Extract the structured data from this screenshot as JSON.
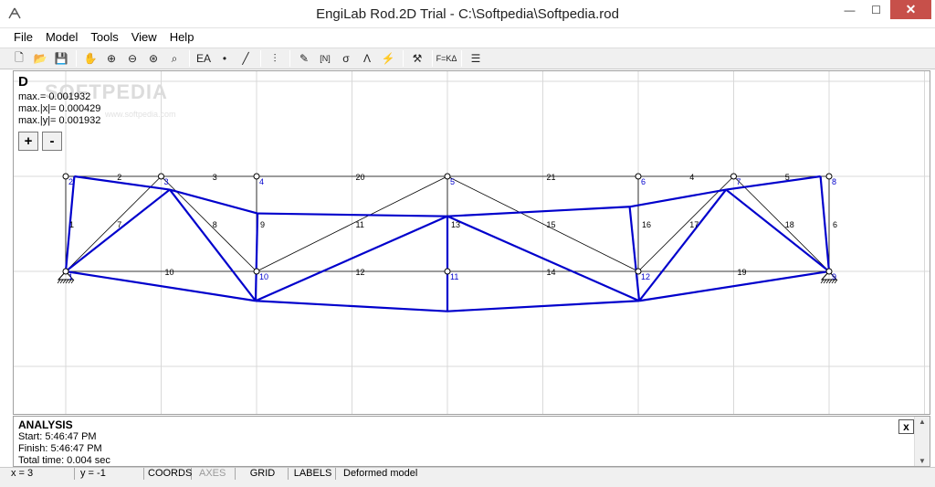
{
  "window": {
    "title": "EngiLab Rod.2D Trial - C:\\Softpedia\\Softpedia.rod",
    "minimize": "—",
    "maximize": "☐",
    "close": "✕"
  },
  "menu": [
    "File",
    "Model",
    "Tools",
    "View",
    "Help"
  ],
  "toolbar": [
    {
      "icon": "new-file-icon",
      "glyph": "🗋"
    },
    {
      "icon": "open-folder-icon",
      "glyph": "📂"
    },
    {
      "icon": "save-icon",
      "glyph": "💾"
    },
    {
      "sep": true
    },
    {
      "icon": "pan-hand-icon",
      "glyph": "✋"
    },
    {
      "icon": "zoom-in-icon",
      "glyph": "⊕"
    },
    {
      "icon": "zoom-out-icon",
      "glyph": "⊖"
    },
    {
      "icon": "zoom-extents-icon",
      "glyph": "⊛"
    },
    {
      "icon": "zoom-window-icon",
      "glyph": "⌕"
    },
    {
      "sep": true
    },
    {
      "icon": "section-properties-icon",
      "glyph": "EA"
    },
    {
      "icon": "node-icon",
      "glyph": "•"
    },
    {
      "icon": "rod-icon",
      "glyph": "╱"
    },
    {
      "sep": true
    },
    {
      "icon": "support-icon",
      "glyph": "⫶"
    },
    {
      "sep": true
    },
    {
      "icon": "pencil-icon",
      "glyph": "✎"
    },
    {
      "icon": "axial-force-icon",
      "glyph": "[N]"
    },
    {
      "icon": "stress-icon",
      "glyph": "σ"
    },
    {
      "icon": "deformed-icon",
      "glyph": "Λ"
    },
    {
      "icon": "lightning-icon",
      "glyph": "⚡"
    },
    {
      "sep": true
    },
    {
      "icon": "tools-icon",
      "glyph": "⚒"
    },
    {
      "sep": true
    },
    {
      "icon": "stiffness-equation-icon",
      "glyph": "F=KΔ"
    },
    {
      "sep": true
    },
    {
      "icon": "report-icon",
      "glyph": "☰"
    }
  ],
  "watermark": {
    "text": "SOFTPEDIA",
    "sub": "www.softpedia.com"
  },
  "results": {
    "title": "D",
    "lines": [
      "max.= 0.001932",
      "max.|x|= 0.000429",
      "max.|y|= 0.001932"
    ],
    "zoom_in": "+",
    "zoom_out": "-"
  },
  "model": {
    "colors": {
      "grid": "#d9d9d9",
      "original": "#000000",
      "deformed": "#0000cc",
      "node_label": "#0000cc"
    },
    "nodes": [
      {
        "id": "1",
        "x": 0,
        "y": 0,
        "support": true
      },
      {
        "id": "2",
        "x": 0,
        "y": 1
      },
      {
        "id": "3",
        "x": 1,
        "y": 1
      },
      {
        "id": "4",
        "x": 2,
        "y": 1
      },
      {
        "id": "5",
        "x": 4,
        "y": 1
      },
      {
        "id": "6",
        "x": 6,
        "y": 1
      },
      {
        "id": "7",
        "x": 7,
        "y": 1
      },
      {
        "id": "8",
        "x": 8,
        "y": 1
      },
      {
        "id": "9",
        "x": 8,
        "y": 0,
        "support": true
      },
      {
        "id": "10",
        "x": 2,
        "y": 0
      },
      {
        "id": "11",
        "x": 4,
        "y": 0
      },
      {
        "id": "12",
        "x": 6,
        "y": 0
      }
    ],
    "deformed_nodes": [
      {
        "id": "1",
        "x": 0,
        "y": 0
      },
      {
        "id": "2",
        "x": 0.09,
        "y": 1
      },
      {
        "id": "3",
        "x": 1.09,
        "y": 0.86
      },
      {
        "id": "4",
        "x": 2.01,
        "y": 0.61
      },
      {
        "id": "5",
        "x": 4,
        "y": 0.58
      },
      {
        "id": "6",
        "x": 5.91,
        "y": 0.68
      },
      {
        "id": "7",
        "x": 6.92,
        "y": 0.86
      },
      {
        "id": "8",
        "x": 7.91,
        "y": 1
      },
      {
        "id": "9",
        "x": 8,
        "y": 0
      },
      {
        "id": "10",
        "x": 1.99,
        "y": -0.31
      },
      {
        "id": "11",
        "x": 4,
        "y": -0.42
      },
      {
        "id": "12",
        "x": 6.01,
        "y": -0.31
      }
    ],
    "rods": [
      {
        "id": "1",
        "a": "1",
        "b": "2"
      },
      {
        "id": "2",
        "a": "2",
        "b": "3"
      },
      {
        "id": "3",
        "a": "3",
        "b": "4"
      },
      {
        "id": "20",
        "a": "4",
        "b": "5"
      },
      {
        "id": "21",
        "a": "5",
        "b": "6"
      },
      {
        "id": "4",
        "a": "6",
        "b": "7"
      },
      {
        "id": "5",
        "a": "7",
        "b": "8"
      },
      {
        "id": "6",
        "a": "8",
        "b": "9"
      },
      {
        "id": "7",
        "a": "1",
        "b": "3"
      },
      {
        "id": "8",
        "a": "3",
        "b": "10"
      },
      {
        "id": "9",
        "a": "4",
        "b": "10"
      },
      {
        "id": "10",
        "a": "1",
        "b": "10"
      },
      {
        "id": "11",
        "a": "10",
        "b": "5"
      },
      {
        "id": "12",
        "a": "10",
        "b": "11"
      },
      {
        "id": "13",
        "a": "5",
        "b": "11"
      },
      {
        "id": "14",
        "a": "11",
        "b": "12"
      },
      {
        "id": "15",
        "a": "5",
        "b": "12"
      },
      {
        "id": "16",
        "a": "6",
        "b": "12"
      },
      {
        "id": "17",
        "a": "12",
        "b": "7"
      },
      {
        "id": "18",
        "a": "7",
        "b": "9"
      },
      {
        "id": "19",
        "a": "12",
        "b": "9"
      }
    ]
  },
  "analysis": {
    "title": "ANALYSIS",
    "lines": [
      "Start:  5:46:47 PM",
      "Finish:  5:46:47 PM",
      "Total time:  0.004 sec"
    ],
    "close": "x"
  },
  "statusbar": {
    "x": "x = 3",
    "y": "y = -1",
    "coords": "COORDS",
    "axes": "AXES",
    "grid": "GRID",
    "labels": "LABELS",
    "mode": "Deformed model"
  }
}
